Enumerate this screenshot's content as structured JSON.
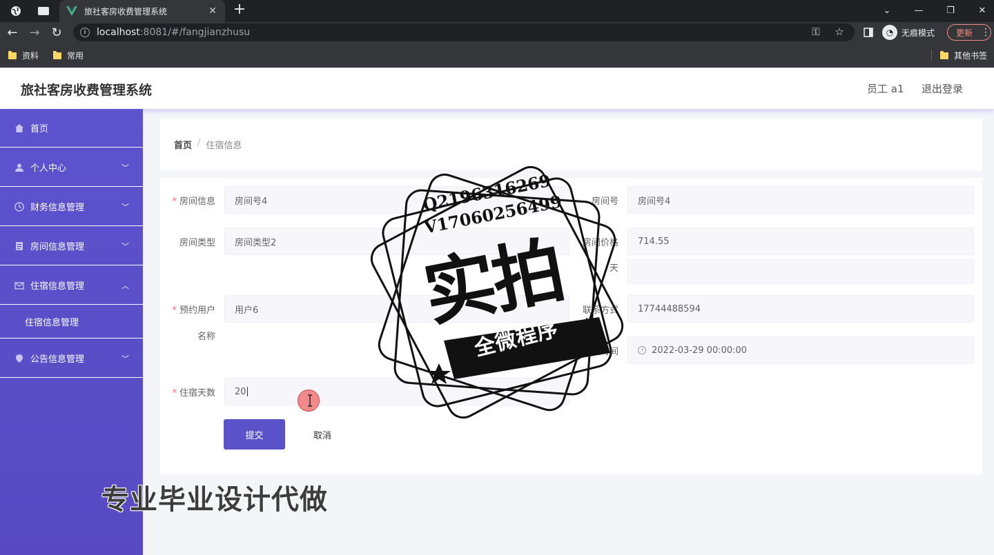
{
  "browser": {
    "tab_title": "旅社客房收费管理系统",
    "url_host": "localhost",
    "url_rest": ":8081/#/fangjianzhusu",
    "incognito_label": "无痕模式",
    "update_label": "更新",
    "bookmarks": [
      "资料",
      "常用"
    ],
    "other_bookmarks": "其他书签"
  },
  "header": {
    "title": "旅社客房收费管理系统",
    "user": "员工 a1",
    "logout": "退出登录"
  },
  "sidebar": {
    "items": [
      {
        "label": "首页",
        "icon": "home-icon"
      },
      {
        "label": "个人中心",
        "icon": "user-icon"
      },
      {
        "label": "财务信息管理",
        "icon": "clock-icon"
      },
      {
        "label": "房间信息管理",
        "icon": "document-icon"
      },
      {
        "label": "住宿信息管理",
        "icon": "mail-icon"
      },
      {
        "label": "公告信息管理",
        "icon": "location-icon"
      }
    ],
    "submenu": [
      "住宿信息管理"
    ]
  },
  "breadcrumb": {
    "home": "首页",
    "separator": "/",
    "current": "住宿信息"
  },
  "form": {
    "room_info_label": "房间信息",
    "room_info_value": "房间号4",
    "room_no_label": "房间号",
    "room_no_value": "房间号4",
    "room_type_label": "房间类型",
    "room_type_value": "房间类型2",
    "room_price_label": "房间价格",
    "room_price_value": "714.55",
    "day_label": "天",
    "booking_user_label_1": "预约用户",
    "booking_user_label_2": "名称",
    "booking_user_value": "用户6",
    "contact_label": "联系方式",
    "contact_value": "17744488594",
    "checkin_time_label": "入住时间",
    "checkin_time_value": "2022-03-29 00:00:00",
    "stay_days_label": "住宿天数",
    "stay_days_value": "20",
    "submit_label": "提交",
    "cancel_label": "取消"
  },
  "watermark": {
    "line1": "Q2196316269",
    "line2": "V17060256499",
    "big": "实拍",
    "ribbon": "全微程序",
    "overlay": "专业毕业设计代做"
  },
  "colors": {
    "sidebar": "#5b51c9",
    "primary_button": "#5b51c9",
    "required": "#f56c6c"
  }
}
